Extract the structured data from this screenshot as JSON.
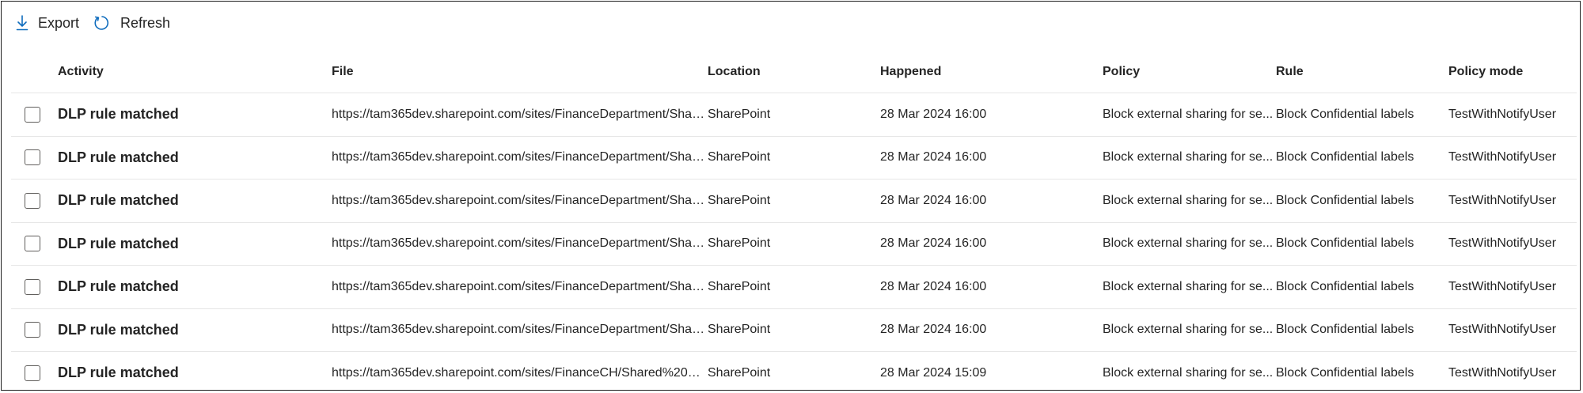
{
  "toolbar": {
    "export_label": "Export",
    "refresh_label": "Refresh",
    "accent": "#0f6cbd"
  },
  "table": {
    "columns": {
      "activity": "Activity",
      "file": "File",
      "location": "Location",
      "happened": "Happened",
      "policy": "Policy",
      "rule": "Rule",
      "mode": "Policy mode"
    },
    "rows": [
      {
        "activity": "DLP rule matched",
        "file": "https://tam365dev.sharepoint.com/sites/FinanceDepartment/Shar...",
        "location": "SharePoint",
        "happened": "28 Mar 2024 16:00",
        "policy": "Block external sharing for se...",
        "rule": "Block Confidential labels",
        "mode": "TestWithNotifyUser"
      },
      {
        "activity": "DLP rule matched",
        "file": "https://tam365dev.sharepoint.com/sites/FinanceDepartment/Shar...",
        "location": "SharePoint",
        "happened": "28 Mar 2024 16:00",
        "policy": "Block external sharing for se...",
        "rule": "Block Confidential labels",
        "mode": "TestWithNotifyUser"
      },
      {
        "activity": "DLP rule matched",
        "file": "https://tam365dev.sharepoint.com/sites/FinanceDepartment/Shar...",
        "location": "SharePoint",
        "happened": "28 Mar 2024 16:00",
        "policy": "Block external sharing for se...",
        "rule": "Block Confidential labels",
        "mode": "TestWithNotifyUser"
      },
      {
        "activity": "DLP rule matched",
        "file": "https://tam365dev.sharepoint.com/sites/FinanceDepartment/Shar...",
        "location": "SharePoint",
        "happened": "28 Mar 2024 16:00",
        "policy": "Block external sharing for se...",
        "rule": "Block Confidential labels",
        "mode": "TestWithNotifyUser"
      },
      {
        "activity": "DLP rule matched",
        "file": "https://tam365dev.sharepoint.com/sites/FinanceDepartment/Shar...",
        "location": "SharePoint",
        "happened": "28 Mar 2024 16:00",
        "policy": "Block external sharing for se...",
        "rule": "Block Confidential labels",
        "mode": "TestWithNotifyUser"
      },
      {
        "activity": "DLP rule matched",
        "file": "https://tam365dev.sharepoint.com/sites/FinanceDepartment/Shar...",
        "location": "SharePoint",
        "happened": "28 Mar 2024 16:00",
        "policy": "Block external sharing for se...",
        "rule": "Block Confidential labels",
        "mode": "TestWithNotifyUser"
      },
      {
        "activity": "DLP rule matched",
        "file": "https://tam365dev.sharepoint.com/sites/FinanceCH/Shared%20Do...",
        "location": "SharePoint",
        "happened": "28 Mar 2024 15:09",
        "policy": "Block external sharing for se...",
        "rule": "Block Confidential labels",
        "mode": "TestWithNotifyUser"
      }
    ]
  }
}
